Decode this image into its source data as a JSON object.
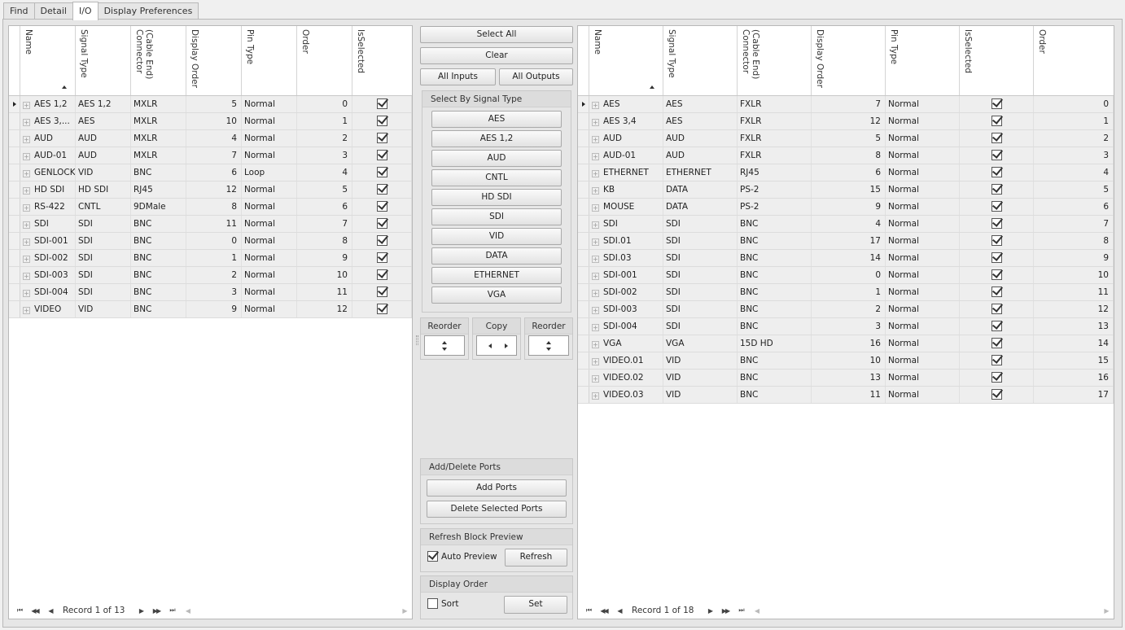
{
  "tabs": [
    "Find",
    "Detail",
    "I/O",
    "Display Preferences"
  ],
  "left_grid": {
    "columns": [
      "Name",
      "Signal Type",
      "(Cable End)\nConnector",
      "Display Order",
      "Pin Type",
      "Order",
      "IsSelected"
    ],
    "rows": [
      [
        "AES 1,2",
        "AES 1,2",
        "MXLR",
        "5",
        "Normal",
        "0"
      ],
      [
        "AES 3,...",
        "AES",
        "MXLR",
        "10",
        "Normal",
        "1"
      ],
      [
        "AUD",
        "AUD",
        "MXLR",
        "4",
        "Normal",
        "2"
      ],
      [
        "AUD-01",
        "AUD",
        "MXLR",
        "7",
        "Normal",
        "3"
      ],
      [
        "GENLOCK",
        "VID",
        "BNC",
        "6",
        "Loop",
        "4"
      ],
      [
        "HD SDI",
        "HD SDI",
        "RJ45",
        "12",
        "Normal",
        "5"
      ],
      [
        "RS-422",
        "CNTL",
        "9DMale",
        "8",
        "Normal",
        "6"
      ],
      [
        "SDI",
        "SDI",
        "BNC",
        "11",
        "Normal",
        "7"
      ],
      [
        "SDI-001",
        "SDI",
        "BNC",
        "0",
        "Normal",
        "8"
      ],
      [
        "SDI-002",
        "SDI",
        "BNC",
        "1",
        "Normal",
        "9"
      ],
      [
        "SDI-003",
        "SDI",
        "BNC",
        "2",
        "Normal",
        "10"
      ],
      [
        "SDI-004",
        "SDI",
        "BNC",
        "3",
        "Normal",
        "11"
      ],
      [
        "VIDEO",
        "VID",
        "BNC",
        "9",
        "Normal",
        "12"
      ]
    ],
    "record_text": "Record 1 of 13"
  },
  "right_grid": {
    "columns": [
      "Name",
      "Signal Type",
      "(Cable End)\nConnector",
      "Display Order",
      "Pin Type",
      "IsSelected",
      "Order"
    ],
    "rows": [
      [
        "AES",
        "AES",
        "FXLR",
        "7",
        "Normal",
        "0"
      ],
      [
        "AES 3,4",
        "AES",
        "FXLR",
        "12",
        "Normal",
        "1"
      ],
      [
        "AUD",
        "AUD",
        "FXLR",
        "5",
        "Normal",
        "2"
      ],
      [
        "AUD-01",
        "AUD",
        "FXLR",
        "8",
        "Normal",
        "3"
      ],
      [
        "ETHERNET",
        "ETHERNET",
        "RJ45",
        "6",
        "Normal",
        "4"
      ],
      [
        "KB",
        "DATA",
        "PS-2",
        "15",
        "Normal",
        "5"
      ],
      [
        "MOUSE",
        "DATA",
        "PS-2",
        "9",
        "Normal",
        "6"
      ],
      [
        "SDI",
        "SDI",
        "BNC",
        "4",
        "Normal",
        "7"
      ],
      [
        "SDI.01",
        "SDI",
        "BNC",
        "17",
        "Normal",
        "8"
      ],
      [
        "SDI.03",
        "SDI",
        "BNC",
        "14",
        "Normal",
        "9"
      ],
      [
        "SDI-001",
        "SDI",
        "BNC",
        "0",
        "Normal",
        "10"
      ],
      [
        "SDI-002",
        "SDI",
        "BNC",
        "1",
        "Normal",
        "11"
      ],
      [
        "SDI-003",
        "SDI",
        "BNC",
        "2",
        "Normal",
        "12"
      ],
      [
        "SDI-004",
        "SDI",
        "BNC",
        "3",
        "Normal",
        "13"
      ],
      [
        "VGA",
        "VGA",
        "15D HD",
        "16",
        "Normal",
        "14"
      ],
      [
        "VIDEO.01",
        "VID",
        "BNC",
        "10",
        "Normal",
        "15"
      ],
      [
        "VIDEO.02",
        "VID",
        "BNC",
        "13",
        "Normal",
        "16"
      ],
      [
        "VIDEO.03",
        "VID",
        "BNC",
        "11",
        "Normal",
        "17"
      ]
    ],
    "record_text": "Record 1 of 18"
  },
  "middle": {
    "select_all": "Select All",
    "clear": "Clear",
    "all_inputs": "All Inputs",
    "all_outputs": "All Outputs",
    "signal_group_title": "Select By Signal Type",
    "signal_types": [
      "AES",
      "AES 1,2",
      "AUD",
      "CNTL",
      "HD SDI",
      "SDI",
      "VID",
      "DATA",
      "ETHERNET",
      "VGA"
    ],
    "reorder_left": "Reorder",
    "copy": "Copy",
    "reorder_right": "Reorder",
    "add_delete_title": "Add/Delete Ports",
    "add_ports": "Add Ports",
    "delete_selected": "Delete Selected Ports",
    "refresh_title": "Refresh Block Preview",
    "auto_preview": "Auto Preview",
    "auto_preview_checked": true,
    "refresh": "Refresh",
    "display_order_title": "Display Order",
    "sort": "Sort",
    "sort_checked": false,
    "set": "Set"
  },
  "colors": {
    "row_bg": "#eeeeee",
    "panel_bg": "#e6e6e6"
  }
}
